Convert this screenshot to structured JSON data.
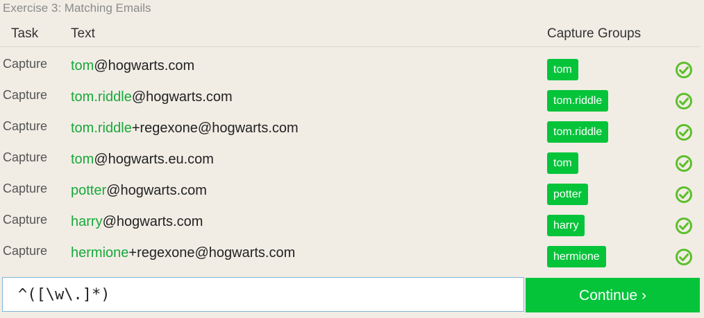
{
  "exercise_title": "Exercise 3: Matching Emails",
  "headers": {
    "task": "Task",
    "text": "Text",
    "groups": "Capture Groups"
  },
  "rows": [
    {
      "task": "Capture",
      "match": "tom",
      "rest": "@hogwarts.com",
      "group": "tom"
    },
    {
      "task": "Capture",
      "match": "tom.riddle",
      "rest": "@hogwarts.com",
      "group": "tom.riddle"
    },
    {
      "task": "Capture",
      "match": "tom.riddle",
      "rest": "+regexone@hogwarts.com",
      "group": "tom.riddle"
    },
    {
      "task": "Capture",
      "match": "tom",
      "rest": "@hogwarts.eu.com",
      "group": "tom"
    },
    {
      "task": "Capture",
      "match": "potter",
      "rest": "@hogwarts.com",
      "group": "potter"
    },
    {
      "task": "Capture",
      "match": "harry",
      "rest": "@hogwarts.com",
      "group": "harry"
    },
    {
      "task": "Capture",
      "match": "hermione",
      "rest": "+regexone@hogwarts.com",
      "group": "hermione"
    }
  ],
  "status_icon": "check-circle-icon",
  "colors": {
    "match": "#18a83a",
    "badge": "#05c43a",
    "check": "#5cbf2a",
    "background": "#f1ede5"
  },
  "regex_input": {
    "value": "^([\\w\\.]*)"
  },
  "continue_label": "Continue ›"
}
